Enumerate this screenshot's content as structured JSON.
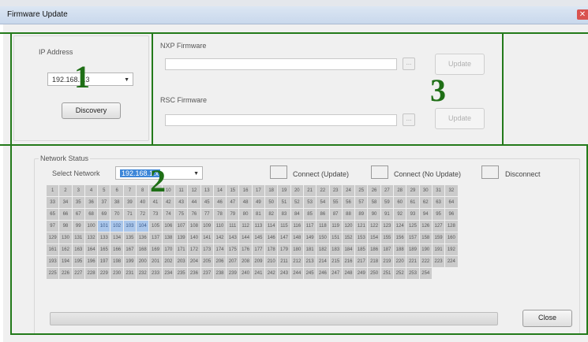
{
  "window": {
    "title": "Firmware Update",
    "close_glyph": "✕"
  },
  "ip_section": {
    "label": "IP Address",
    "value": "192.168.1.3",
    "discovery_label": "Discovery"
  },
  "nxp_section": {
    "label": "NXP Firmware",
    "path": "",
    "browse_glyph": "...",
    "update_label": "Update"
  },
  "rsc_section": {
    "label": "RSC Firmware",
    "path": "",
    "browse_glyph": "...",
    "update_label": "Update"
  },
  "network_status": {
    "label": "Network Status",
    "select_label": "Select Network",
    "selected_network": "192.168.1.x",
    "legend": [
      {
        "label": "Connect (Update)",
        "color": "#aac6ea"
      },
      {
        "label": "Connect (No Update)",
        "color": "#ffffff"
      },
      {
        "label": "Disconnect",
        "color": "#c8c8c8"
      }
    ],
    "node_range": [
      1,
      254
    ],
    "selected_nodes": [
      101,
      102,
      103,
      104
    ]
  },
  "progress": {
    "value": 0
  },
  "close_label": "Close",
  "annotations": {
    "one": "1",
    "two": "2",
    "three": "3"
  },
  "colors": {
    "annotation_green": "#237a1a",
    "selected_node": "#aac6ea",
    "default_node": "#cbcbcb"
  },
  "icons": {
    "combo_arrow": "dropdown-arrow-icon",
    "close": "close-icon"
  }
}
